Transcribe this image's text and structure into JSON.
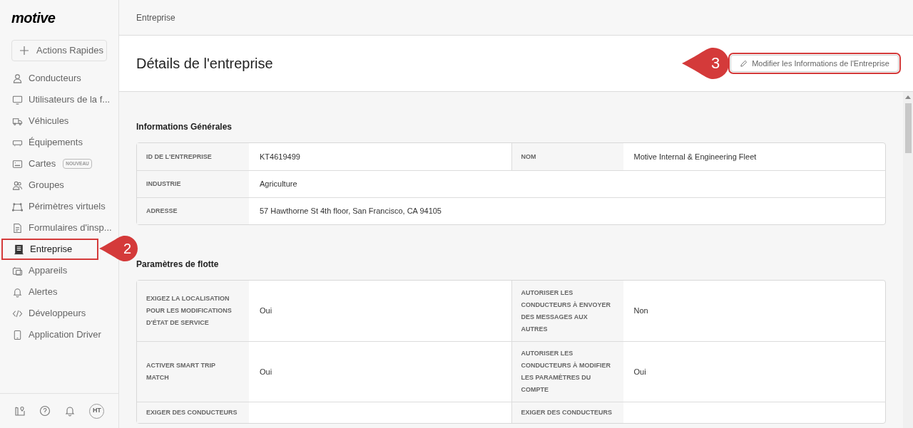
{
  "logo": "motive",
  "quick_action": {
    "label": "Actions Rapides"
  },
  "nav": [
    {
      "label": "Conducteurs",
      "selected": false
    },
    {
      "label": "Utilisateurs de la f...",
      "selected": false
    },
    {
      "label": "Véhicules",
      "selected": false
    },
    {
      "label": "Équipements",
      "selected": false
    },
    {
      "label": "Cartes",
      "selected": false,
      "badge": "NOUVEAU"
    },
    {
      "label": "Groupes",
      "selected": false
    },
    {
      "label": "Périmètres virtuels",
      "selected": false
    },
    {
      "label": "Formulaires d'insp...",
      "selected": false
    },
    {
      "label": "Entreprise",
      "selected": true,
      "callout": "2"
    },
    {
      "label": "Appareils",
      "selected": false
    },
    {
      "label": "Alertes",
      "selected": false
    },
    {
      "label": "Développeurs",
      "selected": false
    },
    {
      "label": "Application Driver",
      "selected": false
    }
  ],
  "avatar": "HT",
  "breadcrumb": "Entreprise",
  "title": "Détails de l'entreprise",
  "edit_button": {
    "label": "Modifier les Informations de l'Entreprise",
    "callout": "3"
  },
  "sections": [
    {
      "title": "Informations Générales",
      "rows": [
        [
          {
            "label": "ID DE L'ENTREPRISE",
            "value": "KT4619499"
          },
          {
            "label": "NOM",
            "value": "Motive Internal & Engineering Fleet"
          }
        ],
        [
          {
            "label": "INDUSTRIE",
            "value": "Agriculture"
          }
        ],
        [
          {
            "label": "ADRESSE",
            "value": "57 Hawthorne St 4th floor, San Francisco, CA 94105"
          }
        ]
      ]
    },
    {
      "title": "Paramètres de flotte",
      "rows": [
        [
          {
            "label": "EXIGEZ LA LOCALISATION POUR LES MODIFICATIONS D'ÉTAT DE SERVICE",
            "value": "Oui"
          },
          {
            "label": "AUTORISER LES CONDUCTEURS À ENVOYER DES MESSAGES AUX AUTRES",
            "value": "Non"
          }
        ],
        [
          {
            "label": "ACTIVER SMART TRIP MATCH",
            "value": "Oui"
          },
          {
            "label": "AUTORISER LES CONDUCTEURS À MODIFIER LES PARAMÈTRES DU COMPTE",
            "value": "Oui"
          }
        ],
        [
          {
            "label": "EXIGER DES CONDUCTEURS"
          },
          {
            "label": "EXIGER DES CONDUCTEURS"
          }
        ]
      ]
    }
  ]
}
